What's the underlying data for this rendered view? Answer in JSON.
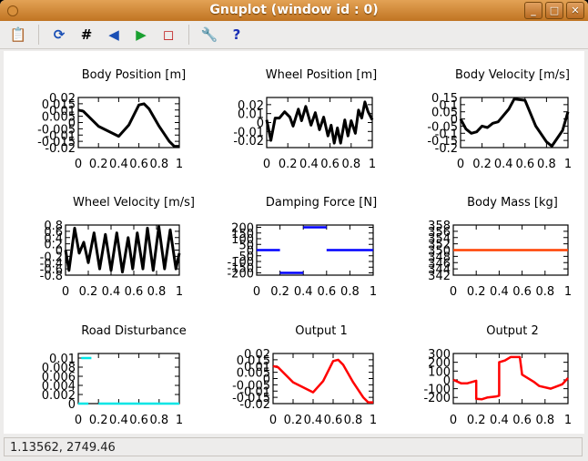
{
  "window": {
    "title": "Gnuplot (window id : 0)",
    "minimize": "_",
    "maximize": "□",
    "close": "✕"
  },
  "toolbar": [
    {
      "name": "copy-clipboard-icon",
      "glyph": "📋"
    },
    {
      "name": "replot-icon",
      "glyph": "⟳",
      "color": "#1a4fb5"
    },
    {
      "name": "grid-icon",
      "glyph": "#",
      "color": "#000"
    },
    {
      "name": "previous-zoom-icon",
      "glyph": "◀",
      "color": "#1a4fb5"
    },
    {
      "name": "next-zoom-icon",
      "glyph": "▶",
      "color": "#1aa030"
    },
    {
      "name": "autoscale-icon",
      "glyph": "◻",
      "color": "#c02020"
    },
    {
      "name": "settings-wrench-icon",
      "glyph": "🔧"
    },
    {
      "name": "help-icon",
      "glyph": "?",
      "color": "#1a2fb5"
    }
  ],
  "status": "1.13562,  2749.46",
  "chart_data": [
    {
      "type": "line",
      "title": "Body Position [m]",
      "color": "#000000",
      "xlim": [
        0,
        1
      ],
      "ylim": [
        -0.02,
        0.02
      ],
      "xticks": [
        0,
        0.2,
        0.4,
        0.6,
        0.8,
        1
      ],
      "xtick_labels": [
        "0",
        "0.2",
        "0.4",
        "0.6",
        "0.8",
        "1"
      ],
      "yticks": [
        -0.02,
        -0.015,
        -0.01,
        -0.005,
        0,
        0.005,
        0.01,
        0.015,
        0.02
      ],
      "ytick_labels": [
        "-0.02",
        "-0.015",
        "-0.01",
        "-0.005",
        "0",
        "0.005",
        "0.01",
        "0.015",
        "0.02"
      ],
      "x": [
        0,
        0.05,
        0.1,
        0.2,
        0.3,
        0.4,
        0.5,
        0.6,
        0.65,
        0.7,
        0.8,
        0.9,
        0.95,
        1
      ],
      "y": [
        0.01,
        0.009,
        0.005,
        -0.003,
        -0.007,
        -0.011,
        -0.002,
        0.014,
        0.015,
        0.011,
        -0.003,
        -0.015,
        -0.019,
        -0.019
      ]
    },
    {
      "type": "line",
      "title": "Wheel Position [m]",
      "color": "#000000",
      "xlim": [
        0,
        1
      ],
      "ylim": [
        -0.028,
        0.028
      ],
      "xticks": [
        0,
        0.2,
        0.4,
        0.6,
        0.8,
        1
      ],
      "xtick_labels": [
        "0",
        "0.2",
        "0.4",
        "0.6",
        "0.8",
        "1"
      ],
      "yticks": [
        -0.02,
        -0.01,
        0,
        0.01,
        0.02
      ],
      "ytick_labels": [
        "-0.02",
        "-0.01",
        "0",
        "0.01",
        "0.02"
      ],
      "x": [
        0,
        0.04,
        0.08,
        0.12,
        0.17,
        0.22,
        0.25,
        0.3,
        0.33,
        0.37,
        0.42,
        0.46,
        0.5,
        0.54,
        0.58,
        0.61,
        0.64,
        0.67,
        0.7,
        0.74,
        0.77,
        0.8,
        0.84,
        0.87,
        0.9,
        0.93,
        0.96,
        1
      ],
      "y": [
        0.003,
        -0.02,
        0.005,
        0.005,
        0.012,
        0.006,
        -0.004,
        0.015,
        0.002,
        0.018,
        -0.003,
        0.011,
        -0.008,
        0.006,
        -0.015,
        -0.003,
        -0.023,
        -0.006,
        -0.023,
        0.003,
        -0.015,
        0.002,
        -0.012,
        0.014,
        0.005,
        0.023,
        0.012,
        0.003
      ]
    },
    {
      "type": "line",
      "title": "Body Velocity [m/s]",
      "color": "#000000",
      "xlim": [
        0,
        1
      ],
      "ylim": [
        -0.2,
        0.15
      ],
      "xticks": [
        0,
        0.2,
        0.4,
        0.6,
        0.8,
        1
      ],
      "xtick_labels": [
        "0",
        "0.2",
        "0.4",
        "0.6",
        "0.8",
        "1"
      ],
      "yticks": [
        -0.2,
        -0.15,
        -0.1,
        -0.05,
        0,
        0.05,
        0.1,
        0.15
      ],
      "ytick_labels": [
        "-0.2",
        "-0.15",
        "-0.1",
        "-0.05",
        "0",
        "0.05",
        "0.1",
        "0.15"
      ],
      "x": [
        0,
        0.05,
        0.1,
        0.15,
        0.2,
        0.25,
        0.3,
        0.35,
        0.45,
        0.5,
        0.6,
        0.7,
        0.8,
        0.85,
        0.95,
        1
      ],
      "y": [
        0,
        -0.07,
        -0.1,
        -0.09,
        -0.05,
        -0.06,
        -0.03,
        -0.02,
        0.07,
        0.14,
        0.13,
        -0.05,
        -0.16,
        -0.19,
        -0.08,
        0.05
      ]
    },
    {
      "type": "line",
      "title": "Wheel Velocity [m/s]",
      "color": "#000000",
      "xlim": [
        0,
        1
      ],
      "ylim": [
        -0.8,
        0.8
      ],
      "xticks": [
        0,
        0.2,
        0.4,
        0.6,
        0.8,
        1
      ],
      "xtick_labels": [
        "0",
        "0.2",
        "0.4",
        "0.6",
        "0.8",
        "1"
      ],
      "yticks": [
        -0.8,
        -0.6,
        -0.4,
        -0.2,
        0,
        0.2,
        0.4,
        0.6,
        0.8
      ],
      "ytick_labels": [
        "-0.8",
        "-0.6",
        "-0.4",
        "-0.2",
        "0",
        "0.2",
        "0.4",
        "0.6",
        "0.8"
      ],
      "x": [
        0,
        0.03,
        0.08,
        0.12,
        0.16,
        0.2,
        0.25,
        0.3,
        0.35,
        0.4,
        0.45,
        0.5,
        0.55,
        0.59,
        0.63,
        0.68,
        0.72,
        0.77,
        0.82,
        0.87,
        0.92,
        0.97,
        1
      ],
      "y": [
        0,
        -0.65,
        0.7,
        -0.1,
        0.25,
        -0.4,
        0.55,
        -0.6,
        0.5,
        -0.65,
        0.55,
        -0.7,
        0.4,
        -0.6,
        0.55,
        -0.6,
        0.7,
        -0.65,
        0.75,
        -0.6,
        0.65,
        -0.6,
        -0.1
      ]
    },
    {
      "type": "line",
      "title": "Damping Force [N]",
      "color": "#0000ff",
      "xlim": [
        0,
        1
      ],
      "ylim": [
        -220,
        220
      ],
      "xticks": [
        0,
        0.2,
        0.4,
        0.6,
        0.8,
        1
      ],
      "xtick_labels": [
        "0",
        "0.2",
        "0.4",
        "0.6",
        "0.8",
        "1"
      ],
      "yticks": [
        -200,
        -150,
        -100,
        -50,
        0,
        50,
        100,
        150,
        200
      ],
      "ytick_labels": [
        "-200",
        "-150",
        "-100",
        "-50",
        "0",
        "50",
        "100",
        "150",
        "200"
      ],
      "x": [
        0,
        0.2,
        null,
        0.2,
        0.4,
        null,
        0.4,
        0.6,
        null,
        0.6,
        1
      ],
      "y": [
        0,
        0,
        null,
        -200,
        -200,
        null,
        200,
        200,
        null,
        0,
        0
      ]
    },
    {
      "type": "line",
      "title": "Body Mass [kg]",
      "color": "#ff4000",
      "xlim": [
        0,
        1
      ],
      "ylim": [
        342,
        358
      ],
      "xticks": [
        0,
        0.2,
        0.4,
        0.6,
        0.8,
        1
      ],
      "xtick_labels": [
        "0",
        "0.2",
        "0.4",
        "0.6",
        "0.8",
        "1"
      ],
      "yticks": [
        342,
        344,
        346,
        348,
        350,
        352,
        354,
        356,
        358
      ],
      "ytick_labels": [
        "342",
        "344",
        "346",
        "348",
        "350",
        "352",
        "354",
        "356",
        "358"
      ],
      "x": [
        0,
        1
      ],
      "y": [
        350,
        350
      ]
    },
    {
      "type": "line",
      "title": "Road Disturbance",
      "color": "#00e5e5",
      "xlim": [
        0,
        1
      ],
      "ylim": [
        0,
        0.011
      ],
      "xticks": [
        0,
        0.2,
        0.4,
        0.6,
        0.8,
        1
      ],
      "xtick_labels": [
        "0",
        "0.2",
        "0.4",
        "0.6",
        "0.8",
        "1"
      ],
      "yticks": [
        0,
        0.002,
        0.004,
        0.006,
        0.008,
        0.01
      ],
      "ytick_labels": [
        "0",
        "0.002",
        "0.004",
        "0.006",
        "0.008",
        "0.01"
      ],
      "x": [
        0,
        0.1,
        null,
        0.03,
        0.13,
        null,
        0.2,
        1
      ],
      "y": [
        0,
        0,
        null,
        0.01,
        0.01,
        null,
        0,
        0
      ]
    },
    {
      "type": "line",
      "title": "Output 1",
      "color": "#ff0000",
      "xlim": [
        0,
        1
      ],
      "ylim": [
        -0.02,
        0.02
      ],
      "xticks": [
        0,
        0.2,
        0.4,
        0.6,
        0.8,
        1
      ],
      "xtick_labels": [
        "0",
        "0.2",
        "0.4",
        "0.6",
        "0.8",
        "1"
      ],
      "yticks": [
        -0.02,
        -0.015,
        -0.01,
        -0.005,
        0,
        0.005,
        0.01,
        0.015,
        0.02
      ],
      "ytick_labels": [
        "-0.02",
        "-0.015",
        "-0.01",
        "-0.005",
        "0",
        "0.005",
        "0.01",
        "0.015",
        "0.02"
      ],
      "x": [
        0,
        0.05,
        0.1,
        0.2,
        0.3,
        0.4,
        0.5,
        0.6,
        0.65,
        0.7,
        0.8,
        0.9,
        0.95,
        1
      ],
      "y": [
        0.01,
        0.009,
        0.005,
        -0.003,
        -0.007,
        -0.011,
        -0.002,
        0.014,
        0.015,
        0.011,
        -0.003,
        -0.015,
        -0.019,
        -0.019
      ]
    },
    {
      "type": "line",
      "title": "Output 2",
      "color": "#ff0000",
      "xlim": [
        0,
        1
      ],
      "ylim": [
        -270,
        300
      ],
      "xticks": [
        0,
        0.2,
        0.4,
        0.6,
        0.8,
        1
      ],
      "xtick_labels": [
        "0",
        "0.2",
        "0.4",
        "0.6",
        "0.8",
        "1"
      ],
      "yticks": [
        -200,
        -100,
        0,
        100,
        200,
        300
      ],
      "ytick_labels": [
        "-200",
        "-100",
        "0",
        "100",
        "200",
        "300"
      ],
      "x": [
        0,
        0.07,
        0.12,
        0.2,
        0.2,
        0.25,
        0.3,
        0.37,
        0.4,
        0.4,
        0.45,
        0.5,
        0.58,
        0.6,
        0.7,
        0.75,
        0.85,
        0.95,
        1
      ],
      "y": [
        0,
        -40,
        -40,
        -10,
        -215,
        -220,
        -200,
        -190,
        -180,
        200,
        220,
        260,
        260,
        60,
        -20,
        -70,
        -100,
        -50,
        20
      ]
    }
  ]
}
